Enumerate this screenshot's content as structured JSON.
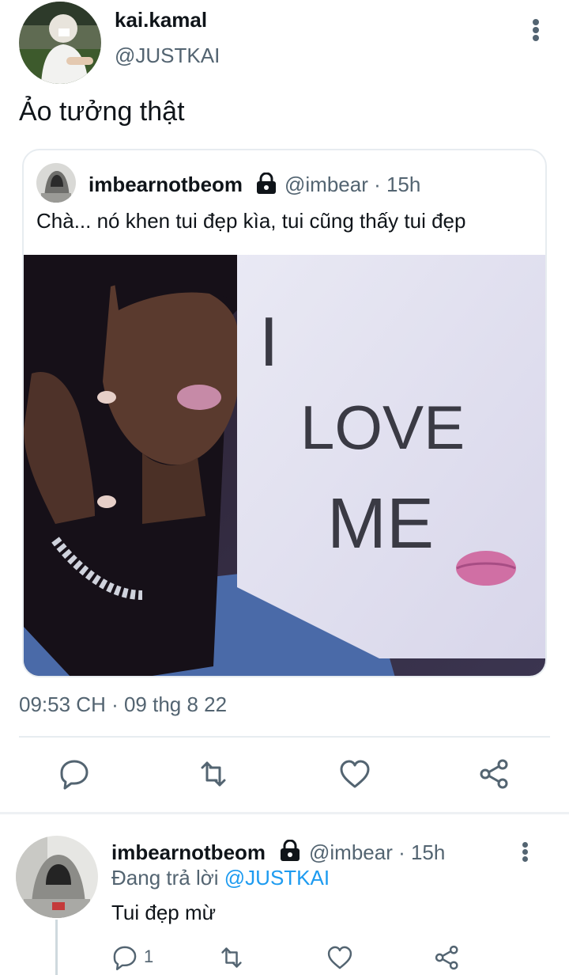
{
  "main_tweet": {
    "display_name": "kai.kamal",
    "handle": "@JUSTKAI",
    "text": "Ảo tưởng thật",
    "timestamp": "09:53 CH · 09 thg 8 22"
  },
  "quoted_tweet": {
    "display_name": "imbearnotbeom",
    "handle_time": "@imbear · 15h",
    "text": "Chà... nó khen tui đẹp kìa, tui cũng thấy tui đẹp",
    "image_sign": [
      "I",
      "LOVE",
      "ME"
    ]
  },
  "reply": {
    "display_name": "imbearnotbeom",
    "handle_time": "@imbear · 15h",
    "replying_prefix": "Đang trả lời ",
    "replying_mention": "@JUSTKAI",
    "text": "Tui đẹp mừ",
    "reply_count": "1"
  },
  "colors": {
    "text": "#0f1419",
    "secondary": "#536471",
    "accent": "#1d9bf0",
    "divider": "#e7ecf0"
  },
  "icons": [
    "reply-icon",
    "retweet-icon",
    "like-icon",
    "share-icon",
    "lock-icon",
    "more-icon"
  ]
}
